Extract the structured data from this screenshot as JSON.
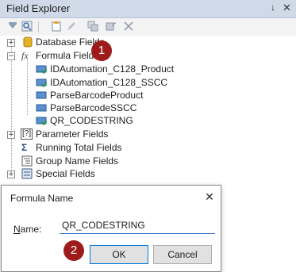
{
  "panel": {
    "title": "Field Explorer",
    "pin_glyph": "↓",
    "close_glyph": "✕"
  },
  "toolbar": {
    "icons": [
      "insert-field-icon",
      "browse-icon",
      "new-icon",
      "edit-icon",
      "duplicate-icon",
      "rename-icon",
      "delete-icon"
    ]
  },
  "tree": {
    "database_fields": "Database Fields",
    "formula_fields": "Formula Fields",
    "formulas": [
      "IDAutomation_C128_Product",
      "IDAutomation_C128_SSCC",
      "ParseBarcodeProduct",
      "ParseBarcodeSSCC",
      "QR_CODESTRING"
    ],
    "parameter_fields": "Parameter Fields",
    "running_total_fields": "Running Total Fields",
    "group_name_fields": "Group Name Fields",
    "special_fields": "Special Fields",
    "formula_icon_text": "fx",
    "parameter_icon_text": "[?]",
    "running_icon_text": "Σ"
  },
  "badges": {
    "step1": "1",
    "step2": "2"
  },
  "dialog": {
    "title": "Formula Name",
    "close_glyph": "✕",
    "name_label_underlined": "N",
    "name_label_rest": "ame:",
    "name_value": "QR_CODESTRING",
    "ok_label": "OK",
    "cancel_label": "Cancel"
  },
  "colors": {
    "titlebar": "#cfd9e8",
    "badge": "#9e1b1b",
    "focus": "#0078d7"
  }
}
